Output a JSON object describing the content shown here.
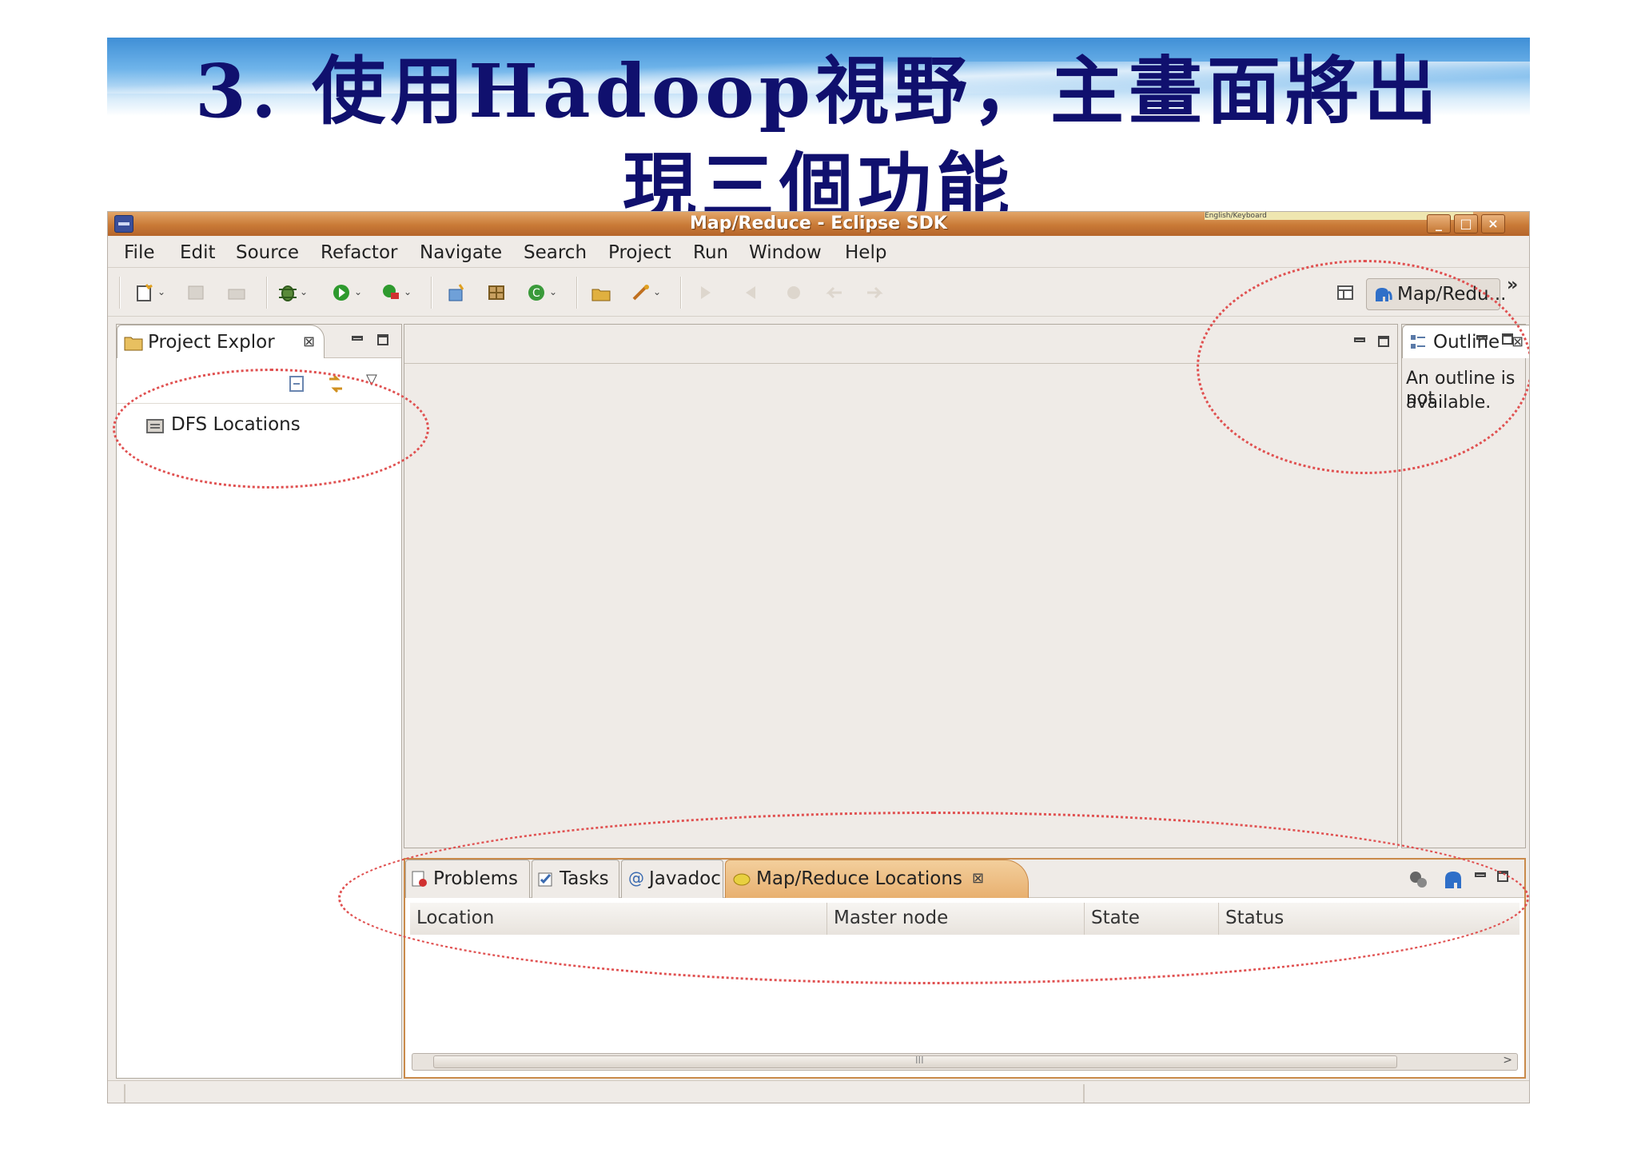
{
  "slide": {
    "title_line1": "3. 使用Hadoop視野，主畫面將出",
    "title_line2": "現三個功能"
  },
  "window": {
    "title": "Map/Reduce - Eclipse SDK",
    "keyboard_indicator": "English/Keyboard",
    "buttons": {
      "minimize": "_",
      "maximize": "□",
      "close": "×"
    }
  },
  "menu": [
    "File",
    "Edit",
    "Source",
    "Refactor",
    "Navigate",
    "Search",
    "Project",
    "Run",
    "Window",
    "Help"
  ],
  "perspective": {
    "label": "Map/Redu...",
    "more": "»"
  },
  "project_explorer": {
    "tab_label": "Project Explor",
    "items": [
      "DFS Locations"
    ]
  },
  "outline": {
    "tab_label": "Outline",
    "message_line1": "An outline is not",
    "message_line2": "available."
  },
  "bottom": {
    "tabs": [
      "Problems",
      "Tasks",
      "Javadoc",
      "Map/Reduce Locations"
    ],
    "columns": [
      "Location",
      "Master node",
      "State",
      "Status"
    ],
    "scroll_label": "III",
    "scroll_right": ">"
  },
  "colors": {
    "title_text": "#10106e",
    "titlebar": "#c97a37",
    "highlight_ellipse": "#e05050"
  }
}
